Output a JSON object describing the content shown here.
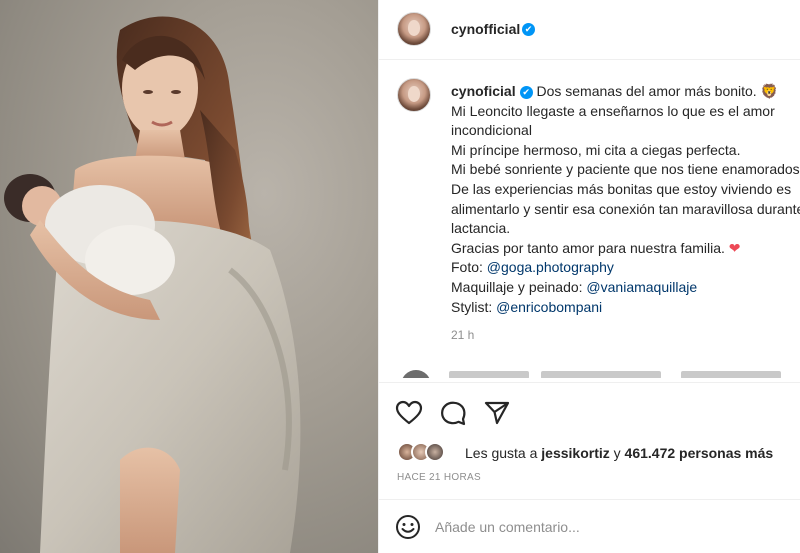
{
  "post": {
    "image_alt": "Mujer sosteniendo a un bebé recién nacido, envuelta en una manta gris"
  },
  "header": {
    "username": "cynofficial",
    "verified_mark": "✔"
  },
  "caption": {
    "username": "cynoficial",
    "lines": [
      "Dos semanas del amor más bonito. 🦁",
      "Mi Leoncito llegaste a enseñarnos lo que es el amor",
      "incondicional",
      "Mi príncipe hermoso, mi cita a ciegas perfecta.",
      "Mi bebé sonriente y paciente que nos tiene enamorados",
      "De las experiencias más bonitas que estoy viviendo es",
      "alimentarlo y sentir esa conexión tan maravillosa durante la",
      "lactancia.",
      "Gracias por tanto amor para nuestra familia. ",
      "Foto: ",
      "Maquillaje y peinado: ",
      "Stylist: "
    ],
    "heart": "❤",
    "photo_credit": "@goga.photography",
    "makeup_credit": "@vaniamaquillaje",
    "stylist_credit": "@enricobompani",
    "time": "21 h"
  },
  "likes": {
    "prefix": "Les gusta a ",
    "user": "jessikortiz",
    "middle": " y ",
    "count": "461.472 personas más"
  },
  "timestamp": "HACE 21 HORAS",
  "comment": {
    "placeholder": "Añade un comentario..."
  },
  "icons": {
    "like": "heart-outline-icon",
    "comment": "comment-bubble-icon",
    "share": "paper-plane-icon",
    "emoji": "smiley-face-icon"
  },
  "colors": {
    "verified": "#0095f6",
    "mention": "#00376b",
    "heart": "#ed4956",
    "muted": "#8e8e8e"
  }
}
